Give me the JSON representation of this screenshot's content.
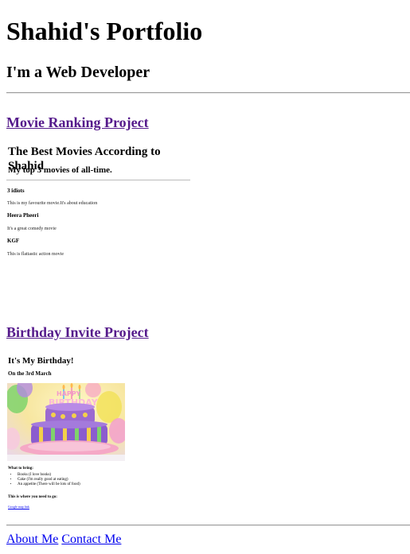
{
  "header": {
    "title": "Shahid's Portfolio",
    "subtitle": "I'm a Web Developer"
  },
  "movie_project": {
    "link_label": "Movie Ranking Project",
    "heading": "The Best Movies According to Shahid",
    "subheading": "My top 3 movies of all-time.",
    "movies": [
      {
        "title": "3 idiots",
        "desc": "This is my favourite movie.It's about education"
      },
      {
        "title": "Heera Pheeri",
        "desc": "It's a great comedy movie"
      },
      {
        "title": "KGF",
        "desc": "This is flattastic action movie"
      }
    ]
  },
  "birthday_project": {
    "link_label": "Birthday Invite Project",
    "heading": "It's My Birthday!",
    "date": "On the 3rd March",
    "bring_heading": "What to bring:",
    "bring_items": [
      "Books (I love books)",
      "Cake (I'm really good at eating)",
      "An appetite (There will be lots of food)"
    ],
    "where_heading": "This is where you need to go:",
    "map_link": "Google map link"
  },
  "footer": {
    "about": "About Me",
    "contact": "Contact Me"
  }
}
